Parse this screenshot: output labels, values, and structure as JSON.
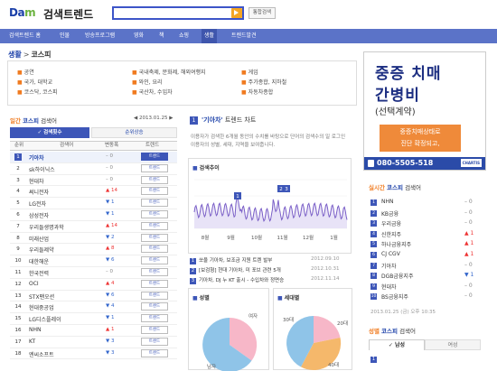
{
  "header": {
    "logo_d": "Da",
    "logo_m": "m",
    "title": "검색트렌드",
    "search_value": "",
    "unified_search": "통합검색"
  },
  "nav": {
    "items": [
      "검색트렌드 홈",
      "인물",
      "방송프로그램",
      "영화",
      "책",
      "쇼핑",
      "생활",
      "트렌드발견"
    ],
    "active": "생활"
  },
  "breadcrumb": {
    "section": "생활",
    "current": "코스피"
  },
  "categories": [
    {
      "label": "공연"
    },
    {
      "label": "국내축제, 문화제, 해외여행지"
    },
    {
      "label": "게임"
    },
    {
      "label": "국가, 대학교"
    },
    {
      "label": "와인, 요리"
    },
    {
      "label": "주가종합, 지하철"
    },
    {
      "label": "코스닥, 코스피",
      "highlight": "코스피"
    },
    {
      "label": "국산차, 수입차"
    },
    {
      "label": "자동차종합"
    }
  ],
  "ad": {
    "line1": "중증 치매",
    "line2": "간병비",
    "line3": "(선택계약)",
    "box_line1": "중증치매상태로",
    "box_line2": "진단 확정되고,",
    "phone": "080-5505-518",
    "brand": "CHARTIS"
  },
  "ranking": {
    "title_period": "일간",
    "title_cat": "코스피",
    "title_suffix": "검색어",
    "date": "2013.01.25",
    "tab_search": "검색횟수",
    "tab_rise": "순위상승",
    "head_rank": "순위",
    "head_keyword": "검색어",
    "head_change": "변동폭",
    "head_trend": "트렌드",
    "trend_btn": "트렌드",
    "rows": [
      {
        "rank": "1",
        "name": "기아차",
        "change": "0",
        "dir": "flat"
      },
      {
        "rank": "2",
        "name": "sk하이닉스",
        "change": "0",
        "dir": "flat"
      },
      {
        "rank": "3",
        "name": "현대차",
        "change": "0",
        "dir": "flat"
      },
      {
        "rank": "4",
        "name": "써니전자",
        "change": "14",
        "dir": "up"
      },
      {
        "rank": "5",
        "name": "LG전자",
        "change": "1",
        "dir": "dn"
      },
      {
        "rank": "6",
        "name": "삼성전자",
        "change": "1",
        "dir": "dn"
      },
      {
        "rank": "7",
        "name": "우리들생명과학",
        "change": "14",
        "dir": "up"
      },
      {
        "rank": "8",
        "name": "미래산업",
        "change": "2",
        "dir": "dn"
      },
      {
        "rank": "9",
        "name": "우리들제약",
        "change": "8",
        "dir": "up"
      },
      {
        "rank": "10",
        "name": "대한해운",
        "change": "6",
        "dir": "dn"
      },
      {
        "rank": "11",
        "name": "한국전력",
        "change": "0",
        "dir": "flat"
      },
      {
        "rank": "12",
        "name": "OCI",
        "change": "4",
        "dir": "up"
      },
      {
        "rank": "13",
        "name": "STX팬오션",
        "change": "6",
        "dir": "dn"
      },
      {
        "rank": "14",
        "name": "현대중공업",
        "change": "4",
        "dir": "dn"
      },
      {
        "rank": "15",
        "name": "LG디스플레이",
        "change": "1",
        "dir": "dn"
      },
      {
        "rank": "16",
        "name": "NHN",
        "change": "1",
        "dir": "up"
      },
      {
        "rank": "17",
        "name": "KT",
        "change": "3",
        "dir": "dn"
      },
      {
        "rank": "18",
        "name": "엔씨소프트",
        "change": "3",
        "dir": "dn"
      }
    ]
  },
  "trend": {
    "num": "1",
    "keyword": "'기아차'",
    "suffix": "트렌드 차트",
    "desc": "이용자가 검색한 6개월 동안의 수치를 바탕으로 단어의 검색수의 일 로그인 이용자의 성별, 세대, 지역을 보여줍니다.",
    "chart_label": "검색추이",
    "months": [
      "8월",
      "9월",
      "10월",
      "11월",
      "12월",
      "1월"
    ],
    "markers": [
      "1",
      "2",
      "3"
    ],
    "articles": [
      {
        "num": "1",
        "text": "쏘울 기아차, 보조금 지원 트렌 발부",
        "date": "2012.09.10"
      },
      {
        "num": "2",
        "text": "[보검형] 현대 기아차, 미 포브 관련 5개",
        "date": "2012.10.31"
      },
      {
        "num": "3",
        "text": "기아차, DJ 누 KT 출시 - 수입차와 정면승",
        "date": "2012.11.14"
      }
    ],
    "gender_label": "성별",
    "age_label": "세대별",
    "female": "여자",
    "male": "남자",
    "age_30": "30대",
    "age_20": "20대",
    "age_40": "40대"
  },
  "realtime": {
    "title_period": "실시간",
    "title_cat": "코스피",
    "title_suffix": "검색어",
    "rows": [
      {
        "n": "1",
        "name": "NHN",
        "change": "0",
        "dir": "flat"
      },
      {
        "n": "2",
        "name": "KB금융",
        "change": "0",
        "dir": "flat"
      },
      {
        "n": "3",
        "name": "우리금융",
        "change": "0",
        "dir": "flat"
      },
      {
        "n": "4",
        "name": "신한지주",
        "change": "1",
        "dir": "up"
      },
      {
        "n": "5",
        "name": "하나금융지주",
        "change": "1",
        "dir": "up"
      },
      {
        "n": "6",
        "name": "CJ CGV",
        "change": "1",
        "dir": "up"
      },
      {
        "n": "7",
        "name": "기아차",
        "change": "0",
        "dir": "flat"
      },
      {
        "n": "8",
        "name": "DGB금융지주",
        "change": "1",
        "dir": "dn"
      },
      {
        "n": "9",
        "name": "현대차",
        "change": "0",
        "dir": "flat"
      },
      {
        "n": "10",
        "name": "BS금융지주",
        "change": "0",
        "dir": "flat"
      }
    ],
    "date": "2013.01.25 (금) 오후 10:35"
  },
  "gender_rank": {
    "title_period": "성별",
    "title_cat": "코스피",
    "title_suffix": "검색어",
    "tab_male": "남성",
    "tab_female": "여성",
    "first": "1"
  },
  "colors": {
    "accent": "#3d56b8",
    "nav": "#5b73c8",
    "orange": "#f07b20",
    "up": "#ee3333",
    "down": "#3366cc"
  }
}
